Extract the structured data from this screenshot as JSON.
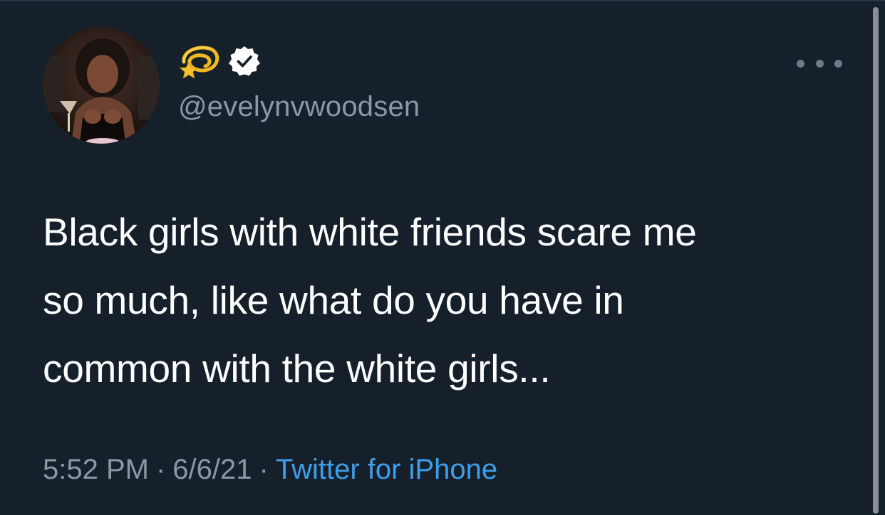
{
  "tweet": {
    "display_name_emoji": "💫",
    "handle": "@evelynvwoodsen",
    "text_lines": [
      "Black girls with white friends scare me",
      "so much, like what do you have in",
      "common with the white girls..."
    ],
    "time": "5:52 PM",
    "separator": "·",
    "date": "6/6/21",
    "source": "Twitter for iPhone"
  },
  "icons": {
    "emoji": "dizzy-star-emoji",
    "verified": "verified-badge",
    "more": "more-options"
  },
  "colors": {
    "background": "#16202b",
    "text": "#ffffff",
    "secondary_text": "#8a98a5",
    "link": "#3d9eea"
  }
}
